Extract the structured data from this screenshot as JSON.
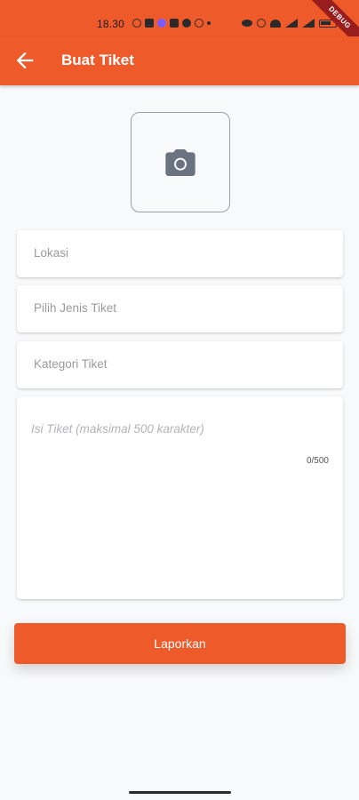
{
  "status_bar": {
    "time": "18.30",
    "debug_label": "DEBUG"
  },
  "app_bar": {
    "title": "Buat Tiket"
  },
  "form": {
    "photo_icon": "camera-icon",
    "lokasi_placeholder": "Lokasi",
    "jenis_placeholder": "Pilih Jenis Tiket",
    "kategori_placeholder": "Kategori Tiket",
    "isi_placeholder": "Isi Tiket (maksimal 500 karakter)",
    "char_counter": "0/500",
    "submit_label": "Laporkan"
  },
  "colors": {
    "primary": "#ee5a2a",
    "background": "#f8f9fb"
  }
}
